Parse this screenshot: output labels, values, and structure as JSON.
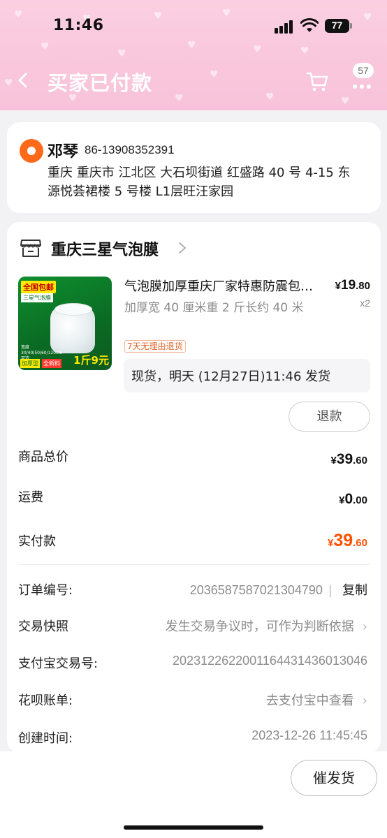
{
  "status_bar": {
    "time": "11:46",
    "battery": "77"
  },
  "navbar": {
    "title": "买家已付款",
    "badge_count": "57"
  },
  "address": {
    "name": "邓琴",
    "phone": "86-13908352391",
    "line1": "重庆 重庆市 江北区 大石坝街道 红盛路 40 号 4-15 东",
    "line2": "源悦荟裙楼 5 号楼 L1层旺汪家园"
  },
  "shop": {
    "name": "重庆三星气泡膜"
  },
  "product": {
    "title": "气泡膜加厚重庆厂家特惠防震包装泡沫",
    "sku": "加厚宽 40 厘米重 2 斤长约 40 米",
    "price_symbol": "¥",
    "price_int": "19",
    "price_dec": ".80",
    "quantity": "x2",
    "return_tag": "7天无理由退货",
    "shipping": "现货，明天 (12月27日)11:46 发货",
    "refund_label": "退款",
    "image_text": {
      "tag1": "全国包邮",
      "tag2": "三星气泡膜",
      "sizes": "宽度30/40/50/60/120cm可选",
      "badge1": "加厚型",
      "badge2": "全新料",
      "price": "1斤9元"
    }
  },
  "summary": {
    "total_label": "商品总价",
    "total_symbol": "¥",
    "total_int": "39",
    "total_dec": ".60",
    "shipping_label": "运费",
    "shipping_symbol": "¥",
    "shipping_int": "0",
    "shipping_dec": ".00",
    "paid_label": "实付款",
    "paid_symbol": "¥",
    "paid_int": "39",
    "paid_dec": ".60"
  },
  "info": {
    "order_no_label": "订单编号:",
    "order_no": "2036587587021304790",
    "copy_label": "复制",
    "snapshot_label": "交易快照",
    "snapshot_value": "发生交易争议时，可作为判断依据",
    "alipay_label": "支付宝交易号:",
    "alipay_value": "2023122622001164431436013046",
    "huabei_label": "花呗账单:",
    "huabei_value": "去支付宝中查看",
    "created_label": "创建时间:",
    "created_value": "2023-12-26 11:45:45"
  },
  "bottom": {
    "urge_label": "催发货"
  },
  "colors": {
    "header_pink": "#f9c7dc",
    "accent_orange": "#ff5000",
    "pin_orange": "#ff6a1a"
  },
  "icons": [
    "back-icon",
    "cart-icon",
    "more-icon",
    "location-pin-icon",
    "store-icon",
    "chevron-right-icon",
    "signal-icon",
    "wifi-icon",
    "battery-icon"
  ]
}
